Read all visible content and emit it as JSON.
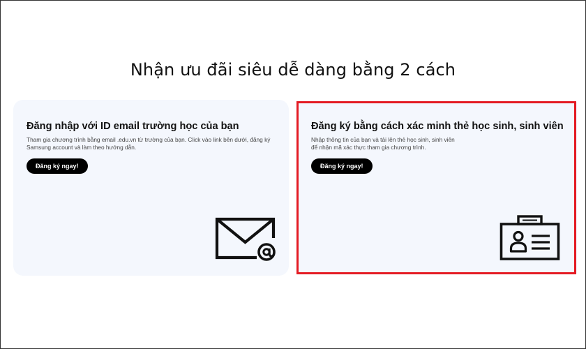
{
  "page": {
    "heading": "Nhận ưu đãi siêu dễ dàng bằng 2 cách"
  },
  "cards": [
    {
      "title": "Đăng nhập với ID email trường học của bạn",
      "description_line1": "Tham gia chương trình bằng email .edu.vn từ trường của bạn. Click vào link bên dưới, đăng ký",
      "description_line2": "Samsung account và làm theo hướng dẫn.",
      "button_label": "Đăng ký ngay!",
      "icon": "envelope-at-icon"
    },
    {
      "title": "Đăng ký bằng cách xác minh thẻ học sinh, sinh viên",
      "description_line1": "Nhập thông tin của bạn và tải lên thẻ học sinh, sinh viên",
      "description_line2": "để nhận mã xác thực tham gia chương trình.",
      "button_label": "Đăng ký ngay!",
      "icon": "id-card-icon"
    }
  ],
  "colors": {
    "highlight_border": "#e41b23",
    "card_background": "#f4f7fd",
    "button_background": "#000000"
  }
}
